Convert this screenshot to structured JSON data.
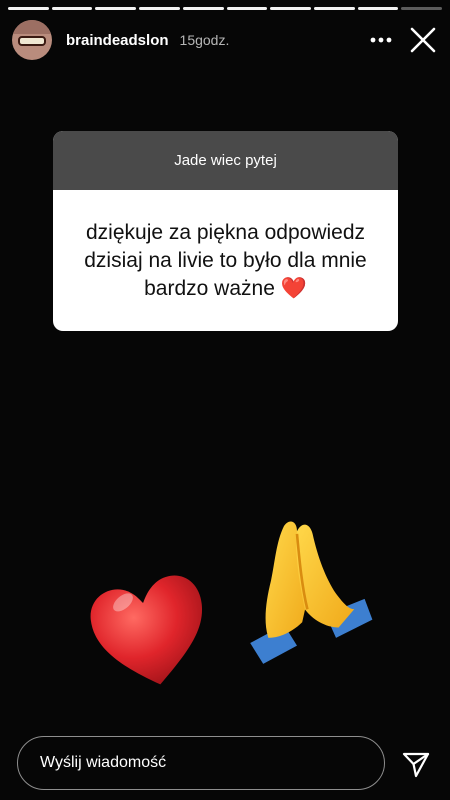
{
  "story": {
    "segments_total": 10,
    "segments_done": 9
  },
  "header": {
    "username": "braindeadslon",
    "time": "15godz.",
    "more_icon": "more-horizontal-icon",
    "close_icon": "close-icon"
  },
  "question_sticker": {
    "question": "Jade wiec pytej",
    "answer_text": "dziękuje za piękna odpowiedz dzisiaj na livie to było dla mnie bardzo ważne",
    "answer_emoji": "❤️"
  },
  "stickers": {
    "heart": "red-heart-emoji",
    "hands": "folded-hands-emoji"
  },
  "footer": {
    "message_placeholder": "Wyślij wiadomość",
    "send_icon": "send-icon"
  },
  "colors": {
    "background": "#060606",
    "card_header": "#4a4a4a",
    "heart": "#e0252b",
    "hands_yellow": "#f7c21c",
    "sleeve_blue": "#3d7fd0"
  }
}
